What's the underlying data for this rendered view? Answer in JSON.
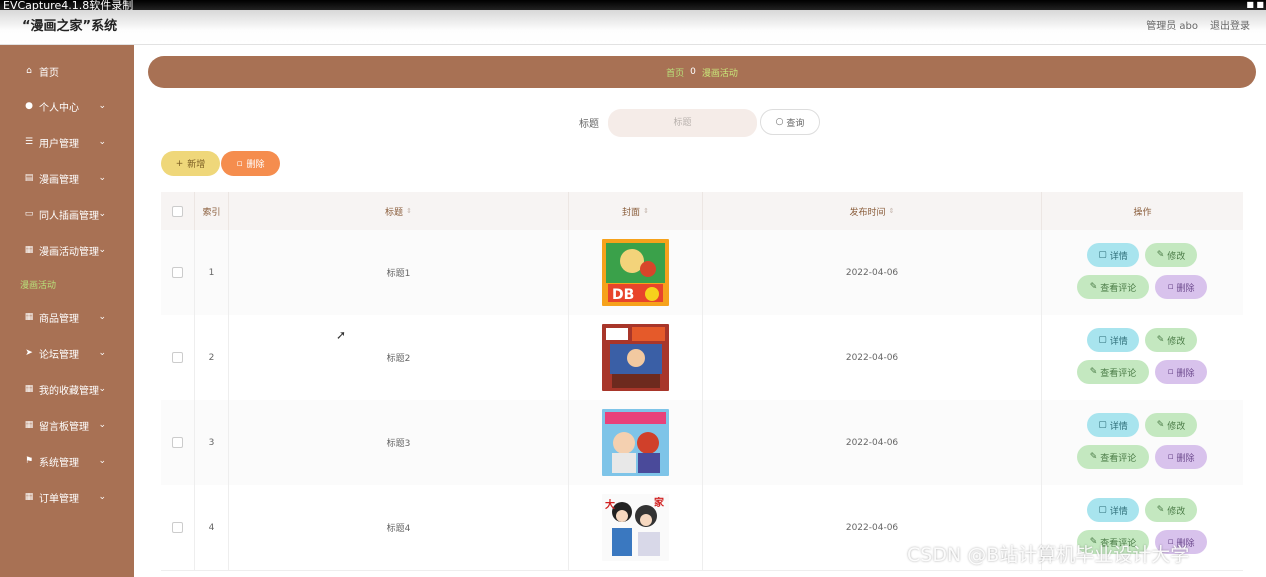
{
  "recorder": {
    "title": "EVCapture4.1.8软件录制",
    "controls": "■ ■"
  },
  "header": {
    "app_title": "“漫画之家”系统",
    "user": "管理员 abo",
    "logout": "退出登录"
  },
  "sidebar": {
    "items": [
      {
        "label": "首页",
        "icon": "home-icon",
        "glyph": "⌂",
        "expandable": false
      },
      {
        "label": "个人中心",
        "icon": "person-icon",
        "glyph": "👤",
        "expandable": true
      },
      {
        "label": "用户管理",
        "icon": "menu-icon",
        "glyph": "☰",
        "expandable": true
      },
      {
        "label": "漫画管理",
        "icon": "book-icon",
        "glyph": "▤",
        "expandable": true
      },
      {
        "label": "同人插画管理",
        "icon": "folder-icon",
        "glyph": "▭",
        "expandable": true
      },
      {
        "label": "漫画活动管理",
        "icon": "grid-icon",
        "glyph": "▦",
        "expandable": true
      },
      {
        "label": "商品管理",
        "icon": "grid-icon",
        "glyph": "▦",
        "expandable": true
      },
      {
        "label": "论坛管理",
        "icon": "send-icon",
        "glyph": "➤",
        "expandable": true
      },
      {
        "label": "我的收藏管理",
        "icon": "grid-icon",
        "glyph": "▦",
        "expandable": true
      },
      {
        "label": "留言板管理",
        "icon": "grid-icon",
        "glyph": "▦",
        "expandable": true
      },
      {
        "label": "系统管理",
        "icon": "flag-icon",
        "glyph": "⚑",
        "expandable": true
      },
      {
        "label": "订单管理",
        "icon": "grid-icon",
        "glyph": "▦",
        "expandable": true
      }
    ],
    "active_sub": "漫画活动"
  },
  "breadcrumb": {
    "home": "首页",
    "separator": "0",
    "current": "漫画活动"
  },
  "search": {
    "label": "标题",
    "placeholder": "标题",
    "button": "查询"
  },
  "toolbar": {
    "add": "新增",
    "delete": "删除"
  },
  "table": {
    "columns": [
      "索引",
      "标题",
      "封面",
      "发布时间",
      "操作"
    ],
    "rows": [
      {
        "index": "1",
        "title": "标题1",
        "date": "2022-04-06"
      },
      {
        "index": "2",
        "title": "标题2",
        "date": "2022-04-06"
      },
      {
        "index": "3",
        "title": "标题3",
        "date": "2022-04-06"
      },
      {
        "index": "4",
        "title": "标题4",
        "date": "2022-04-06"
      }
    ],
    "actions": {
      "detail": "详情",
      "edit": "修改",
      "comments": "查看评论",
      "remove": "删除"
    }
  },
  "watermark": "CSDN @B站计算机毕业设计大学",
  "colors": {
    "sidebar": "#a87154",
    "accent_green": "#b8e07a",
    "add": "#efd77a",
    "delete": "#f58d4e"
  }
}
